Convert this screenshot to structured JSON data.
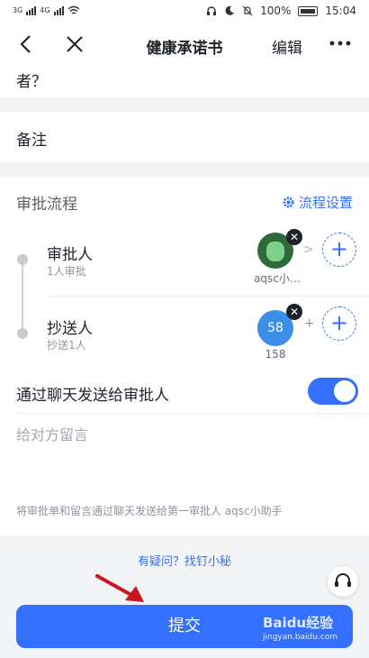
{
  "status_bar": {
    "signal_1": "3G",
    "signal_2": "4G",
    "battery": "100%",
    "time": "15:04"
  },
  "nav": {
    "title": "健康承诺书",
    "edit": "编辑"
  },
  "form": {
    "question_tail": "者？",
    "remark_label": "备注"
  },
  "approval_flow": {
    "title": "审批流程",
    "settings_label": "流程设置",
    "steps": [
      {
        "title": "审批人",
        "sub": "1人审批",
        "assignee_name": "aqsc小…"
      },
      {
        "title": "抄送人",
        "sub": "抄送1人",
        "badge": "58",
        "badge_name": "158"
      }
    ]
  },
  "chat": {
    "label": "通过聊天发送给审批人",
    "toggle_on": true,
    "message_placeholder": "给对方留言",
    "hint": "将审批单和留言通过聊天发送给第一审批人 aqsc小助手"
  },
  "footer": {
    "help_link": "有疑问？找钉小秘",
    "submit": "提交"
  },
  "watermark": {
    "brand": "Baidu经验",
    "url": "jingyan.baidu.com"
  },
  "colors": {
    "accent": "#3370ff",
    "arrow": "#c8171e"
  }
}
